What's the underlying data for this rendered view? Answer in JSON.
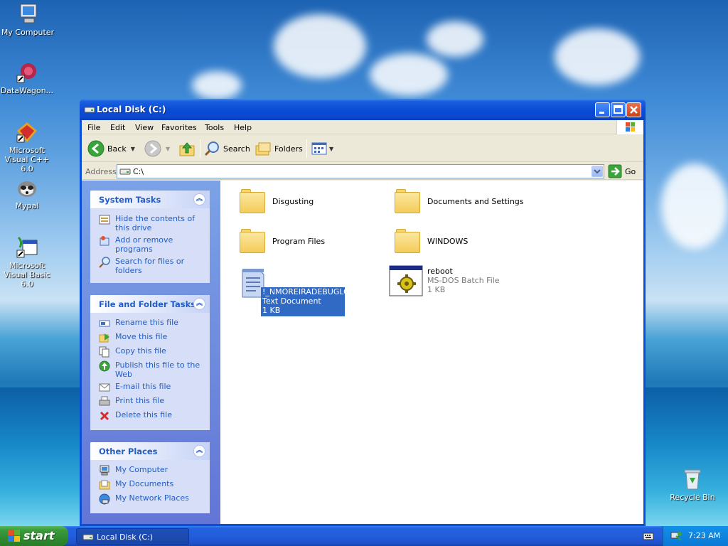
{
  "desktop": {
    "icons": [
      {
        "label": "My Computer"
      },
      {
        "label": "DataWagon..."
      },
      {
        "label": "Microsoft Visual C++ 6.0"
      },
      {
        "label": "Mypal"
      },
      {
        "label": "Microsoft Visual Basic 6.0"
      },
      {
        "label": "Recycle Bin"
      }
    ]
  },
  "window": {
    "title": "Local Disk (C:)",
    "menu": [
      "File",
      "Edit",
      "View",
      "Favorites",
      "Tools",
      "Help"
    ],
    "toolbar": {
      "back": "Back",
      "search": "Search",
      "folders": "Folders"
    },
    "address": {
      "label": "Address",
      "value": "C:\\",
      "go": "Go"
    },
    "panels": {
      "system_tasks": {
        "title": "System Tasks",
        "items": [
          "Hide the contents of this drive",
          "Add or remove programs",
          "Search for files or folders"
        ]
      },
      "file_tasks": {
        "title": "File and Folder Tasks",
        "items": [
          "Rename this file",
          "Move this file",
          "Copy this file",
          "Publish this file to the Web",
          "E-mail this file",
          "Print this file",
          "Delete this file"
        ]
      },
      "other_places": {
        "title": "Other Places",
        "items": [
          "My Computer",
          "My Documents",
          "My Network Places"
        ]
      }
    },
    "files": [
      {
        "name": "Disgusting",
        "type": "folder"
      },
      {
        "name": "Documents and Settings",
        "type": "folder"
      },
      {
        "name": "Program Files",
        "type": "folder"
      },
      {
        "name": "WINDOWS",
        "type": "folder"
      },
      {
        "name": "!_NMOREIRADEBUGLOG",
        "desc": "Text Document",
        "size": "1 KB",
        "selected": true
      },
      {
        "name": "reboot",
        "desc": "MS-DOS Batch File",
        "size": "1 KB"
      }
    ]
  },
  "taskbar": {
    "start": "start",
    "task": "Local Disk (C:)",
    "clock": "7:23 AM"
  }
}
